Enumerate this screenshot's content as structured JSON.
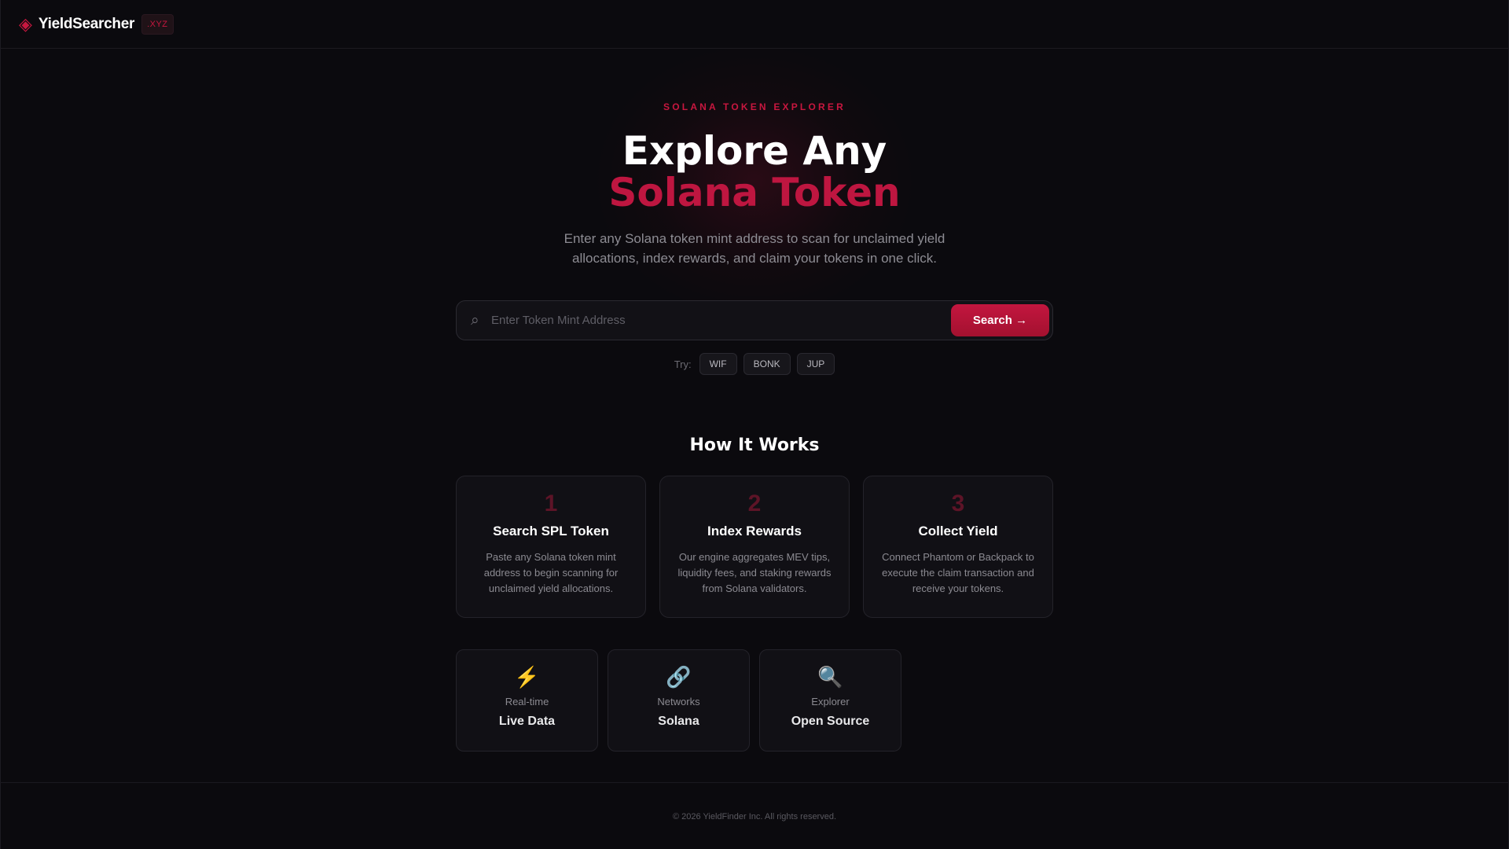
{
  "header": {
    "logo_icon": "◈",
    "brand": "YieldSearcher",
    "tld": ".XYZ"
  },
  "hero": {
    "eyebrow": "SOLANA TOKEN EXPLORER",
    "title_line1": "Explore Any",
    "title_line2": "Solana Token",
    "subtitle": "Enter any Solana token mint address to scan for unclaimed yield allocations, index rewards, and claim your tokens in one click."
  },
  "search": {
    "icon": "⌕",
    "placeholder": "Enter Token Mint Address",
    "value": "",
    "button_label": "Search →"
  },
  "try": {
    "label": "Try:",
    "chips": [
      "WIF",
      "BONK",
      "JUP"
    ]
  },
  "how": {
    "title": "How It Works",
    "steps": [
      {
        "num": "1",
        "title": "Search SPL Token",
        "desc": "Paste any Solana token mint address to begin scanning for unclaimed yield allocations."
      },
      {
        "num": "2",
        "title": "Index Rewards",
        "desc": "Our engine aggregates MEV tips, liquidity fees, and staking rewards from Solana validators."
      },
      {
        "num": "3",
        "title": "Collect Yield",
        "desc": "Connect Phantom or Backpack to execute the claim transaction and receive your tokens."
      }
    ]
  },
  "stats": [
    {
      "icon": "⚡",
      "icon_name": "lightning-icon",
      "label": "Real-time",
      "value": "Live Data"
    },
    {
      "icon": "🔗",
      "icon_name": "link-icon",
      "label": "Networks",
      "value": "Solana"
    },
    {
      "icon": "🔍",
      "icon_name": "magnifier-icon",
      "label": "Explorer",
      "value": "Open Source"
    }
  ],
  "footer": {
    "text": "© 2026 YieldFinder Inc. All rights reserved."
  },
  "colors": {
    "accent": "#c8173f",
    "background": "#0b0a0e",
    "card": "#111015"
  }
}
